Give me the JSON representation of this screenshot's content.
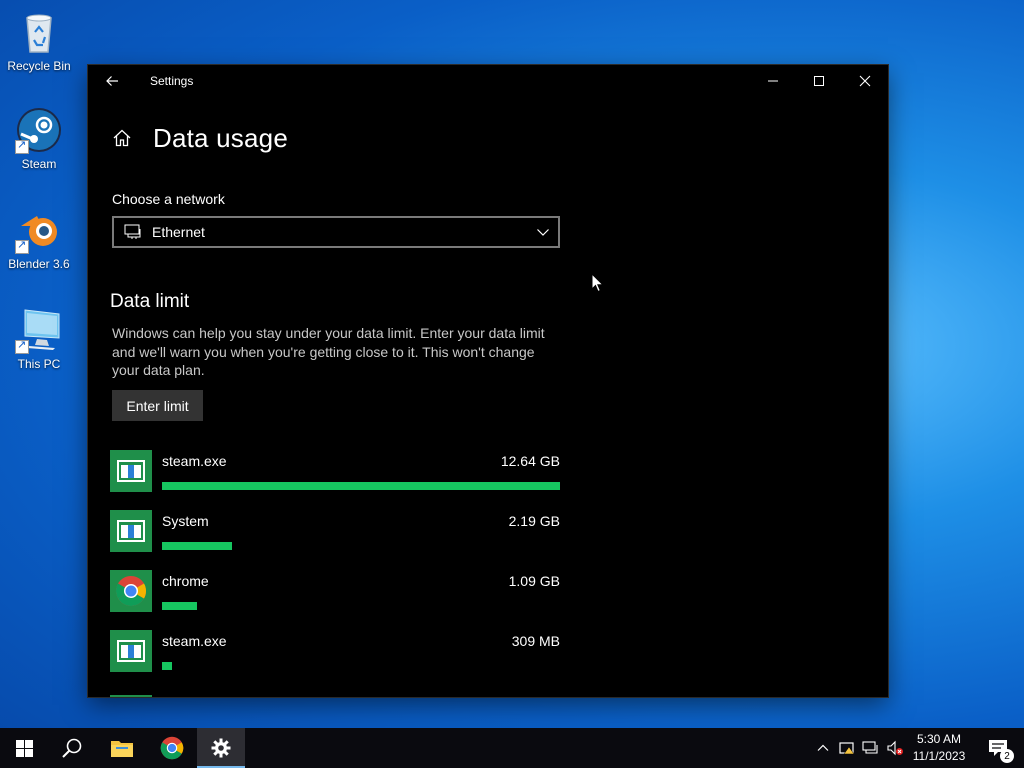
{
  "desktop": {
    "icons": [
      {
        "label": "Recycle Bin"
      },
      {
        "label": "Steam"
      },
      {
        "label": "Blender 3.6"
      },
      {
        "label": "This PC"
      }
    ]
  },
  "window": {
    "title": "Settings",
    "page_title": "Data usage",
    "network_label": "Choose a network",
    "network_value": "Ethernet",
    "data_limit_title": "Data limit",
    "data_limit_desc": "Windows can help you stay under your data limit. Enter your data limit and we'll warn you when you're getting close to it. This won't change your data plan.",
    "enter_limit_label": "Enter limit",
    "apps": [
      {
        "name": "steam.exe",
        "size": "12.64 GB",
        "fraction": 1.0,
        "icon": "generic-app-icon"
      },
      {
        "name": "System",
        "size": "2.19 GB",
        "fraction": 0.175,
        "icon": "generic-app-icon"
      },
      {
        "name": "chrome",
        "size": "1.09 GB",
        "fraction": 0.087,
        "icon": "chrome-icon"
      },
      {
        "name": "steam.exe",
        "size": "309 MB",
        "fraction": 0.025,
        "icon": "generic-app-icon"
      }
    ]
  },
  "taskbar": {
    "time": "5:30 AM",
    "date": "11/1/2023",
    "notification_count": "2"
  },
  "colors": {
    "accent_green": "#16c660",
    "window_bg": "#000000",
    "taskbar_bg": "#0a0a0f"
  }
}
